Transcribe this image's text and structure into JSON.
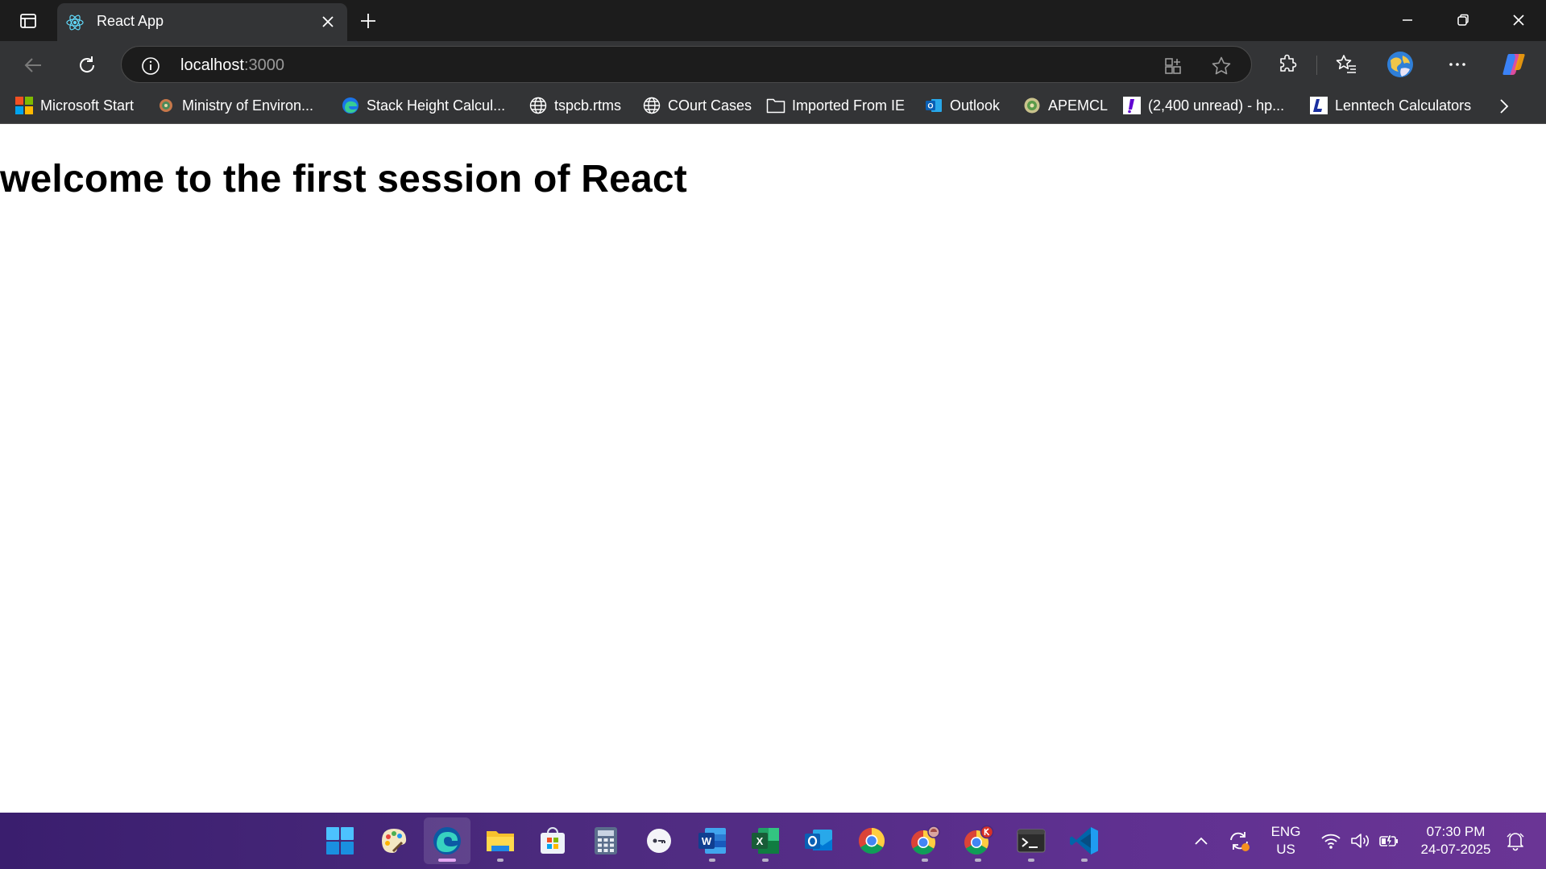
{
  "browser": {
    "tab": {
      "title": "React App",
      "favicon": "react-icon"
    },
    "address": {
      "host": "localhost",
      "port": ":3000"
    },
    "favorites": [
      {
        "label": "Microsoft Start",
        "icon": "microsoft-logo-icon"
      },
      {
        "label": "Ministry of Environ...",
        "icon": "emblem-icon"
      },
      {
        "label": "Stack Height Calcul...",
        "icon": "edge-icon"
      },
      {
        "label": "tspcb.rtms",
        "icon": "globe-icon"
      },
      {
        "label": "COurt Cases",
        "icon": "globe-icon"
      },
      {
        "label": "Imported From IE",
        "icon": "folder-icon"
      },
      {
        "label": "Outlook",
        "icon": "outlook-icon"
      },
      {
        "label": "APEMCL",
        "icon": "seal-icon"
      },
      {
        "label": "(2,400 unread) - hp...",
        "icon": "yahoo-mail-icon"
      },
      {
        "label": "Lenntech Calculators",
        "icon": "lenntech-icon"
      }
    ]
  },
  "page": {
    "heading": "welcome to the first session of React"
  },
  "taskbar": {
    "apps": [
      "start-icon",
      "paint-icon",
      "edge-icon",
      "file-explorer-icon",
      "store-icon",
      "calculator-icon",
      "connect-icon",
      "word-icon",
      "excel-icon",
      "outlook-icon",
      "chrome-icon",
      "chrome-profile-icon",
      "chrome-profile-k-icon",
      "terminal-icon",
      "vscode-icon"
    ],
    "tray": {
      "lang_line1": "ENG",
      "lang_line2": "US",
      "time": "07:30 PM",
      "date": "24-07-2025"
    }
  },
  "colors": {
    "tab_strip": "#1c1c1c",
    "toolbar": "#333436",
    "taskbar_start": "#3a1e6e",
    "taskbar_end": "#6a3595",
    "active_indicator": "#e3a6f2"
  }
}
